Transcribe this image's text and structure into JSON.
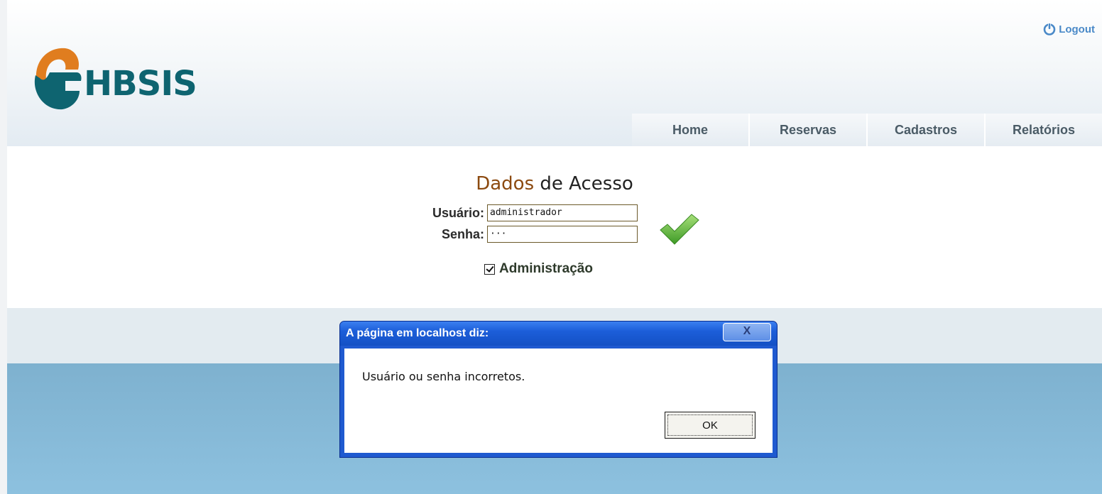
{
  "header": {
    "logo_text": "HBSIS",
    "logout_label": "Logout",
    "nav": [
      "Home",
      "Reservas",
      "Cadastros",
      "Relatórios"
    ]
  },
  "login": {
    "title_highlight": "Dados",
    "title_rest": " de Acesso",
    "user_label": "Usuário:",
    "user_value": "administrador",
    "password_label": "Senha:",
    "password_masked": "···",
    "admin_label": "Administração",
    "admin_checked": true
  },
  "dialog": {
    "title": "A página em localhost diz:",
    "close_label": "X",
    "message": "Usuário ou senha incorretos.",
    "ok_label": "OK"
  },
  "colors": {
    "brand_teal": "#0e6470",
    "brand_orange": "#e07d1f",
    "link_blue": "#4a89c8",
    "title_highlight": "#8c4a10",
    "dialog_blue": "#1f5ad0"
  },
  "icons": [
    "power-icon",
    "checkmark-icon",
    "logo-icon"
  ]
}
